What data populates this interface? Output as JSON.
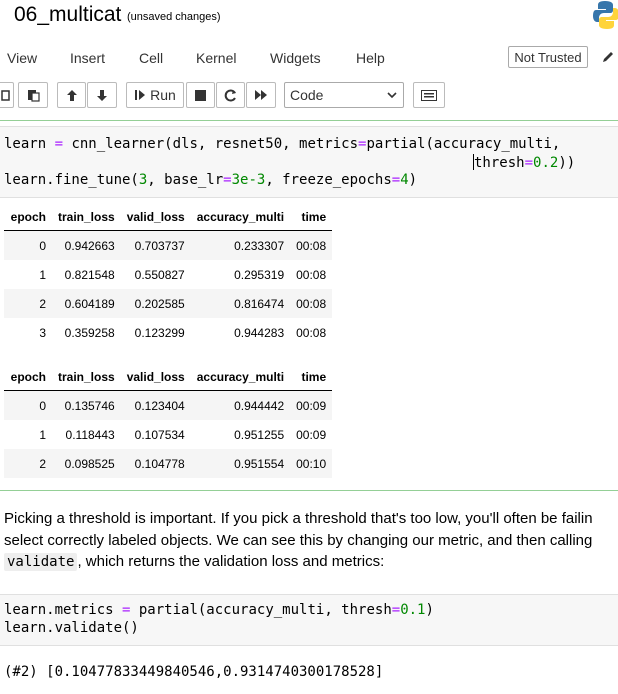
{
  "notebook": {
    "title": "06_multicat",
    "status": "(unsaved changes)"
  },
  "menubar": {
    "items": [
      "View",
      "Insert",
      "Cell",
      "Kernel",
      "Widgets",
      "Help"
    ],
    "trust": "Not Trusted"
  },
  "toolbar": {
    "run_label": "Run",
    "cell_type": "Code"
  },
  "cell1": {
    "line1a": "learn ",
    "line1b": "=",
    "line1c": " cnn_learner(dls, resnet50, metrics",
    "line1d": "=",
    "line1e": "partial(accuracy_multi,",
    "line2a": "thresh",
    "line2b": "=",
    "line2c": "0.2",
    "line2d": "))",
    "line3a": "learn.fine_tune(",
    "line3b": "3",
    "line3c": ", base_lr",
    "line3d": "=",
    "line3e": "3e-3",
    "line3f": ", freeze_epochs",
    "line3g": "=",
    "line3h": "4",
    "line3i": ")"
  },
  "table1": {
    "headers": [
      "epoch",
      "train_loss",
      "valid_loss",
      "accuracy_multi",
      "time"
    ],
    "rows": [
      [
        "0",
        "0.942663",
        "0.703737",
        "0.233307",
        "00:08"
      ],
      [
        "1",
        "0.821548",
        "0.550827",
        "0.295319",
        "00:08"
      ],
      [
        "2",
        "0.604189",
        "0.202585",
        "0.816474",
        "00:08"
      ],
      [
        "3",
        "0.359258",
        "0.123299",
        "0.944283",
        "00:08"
      ]
    ]
  },
  "table2": {
    "headers": [
      "epoch",
      "train_loss",
      "valid_loss",
      "accuracy_multi",
      "time"
    ],
    "rows": [
      [
        "0",
        "0.135746",
        "0.123404",
        "0.944442",
        "00:09"
      ],
      [
        "1",
        "0.118443",
        "0.107534",
        "0.951255",
        "00:09"
      ],
      [
        "2",
        "0.098525",
        "0.104778",
        "0.951554",
        "00:10"
      ]
    ]
  },
  "markdown": {
    "line1": "Picking a threshold is important. If you pick a threshold that's too low, you'll often be failin",
    "line2": "select correctly labeled objects. We can see this by changing our metric, and then calling",
    "line3_code": "validate",
    "line3_rest": ", which returns the validation loss and metrics:"
  },
  "cell2": {
    "line1a": "learn.metrics ",
    "line1b": "=",
    "line1c": " partial(accuracy_multi, thresh",
    "line1d": "=",
    "line1e": "0.1",
    "line1f": ")",
    "line2": "learn.validate()"
  },
  "output": {
    "text": "(#2) [0.10477833449840546,0.9314740300178528]"
  }
}
